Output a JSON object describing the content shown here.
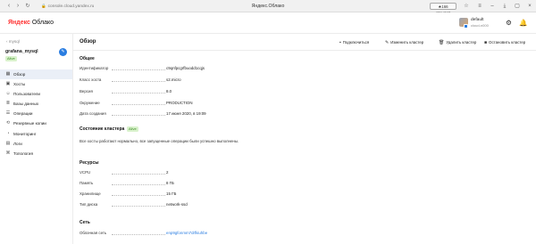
{
  "browser": {
    "url": "console.cloud.yandex.ru",
    "tab_title": "Яндекс.Облако",
    "reviews": "★166 отзывов"
  },
  "app": {
    "logo_ya": "Яндекс",
    "logo_rest": " Облако",
    "user_name": "default",
    "user_cloud": "cloud-n000"
  },
  "sidebar": {
    "back": "‹ mysql",
    "cluster_name": "grafana_mysql",
    "cluster_status": "Alive",
    "items": [
      {
        "label": "Обзор",
        "icon": "overview-icon"
      },
      {
        "label": "Хосты",
        "icon": "hosts-icon"
      },
      {
        "label": "Пользователи",
        "icon": "users-icon"
      },
      {
        "label": "Базы данных",
        "icon": "databases-icon"
      },
      {
        "label": "Операции",
        "icon": "operations-icon"
      },
      {
        "label": "Резервные копии",
        "icon": "backups-icon"
      },
      {
        "label": "Мониторинг",
        "icon": "monitoring-icon"
      },
      {
        "label": "Логи",
        "icon": "logs-icon"
      },
      {
        "label": "Топология",
        "icon": "topology-icon"
      }
    ]
  },
  "main": {
    "title": "Обзор",
    "toolbar": {
      "connect": "Подключиться",
      "edit": "Изменить кластер",
      "delete": "Удалить кластер",
      "stop": "Остановить кластер"
    },
    "general": {
      "title": "Общее",
      "rows": [
        {
          "key": "Идентификатор",
          "value": "c9qnfpcgrfbuodd1cqjs"
        },
        {
          "key": "Класс хоста",
          "value": "s2.micro"
        },
        {
          "key": "Версия",
          "value": "8.0"
        },
        {
          "key": "Окружение",
          "value": "PRODUCTION"
        },
        {
          "key": "Дата создания",
          "value": "17 июня 2020, в 19:09"
        }
      ]
    },
    "state": {
      "title": "Состояние кластера",
      "badge": "Alive",
      "text": "Все хосты работают нормально, все запущенные операции были успешно выполнены."
    },
    "resources": {
      "title": "Ресурсы",
      "rows": [
        {
          "key": "VCPU",
          "value": "2"
        },
        {
          "key": "Память",
          "value": "8 ГБ"
        },
        {
          "key": "Хранилище",
          "value": "15 ГБ"
        },
        {
          "key": "Тип диска",
          "value": "network-ssd"
        }
      ]
    },
    "network": {
      "title": "Сеть",
      "rows": [
        {
          "key": "Облачная сеть",
          "value": "enp9gfonmm7drfkiuhbe"
        }
      ]
    }
  },
  "colors": {
    "accent": "#2a7de1",
    "alive_bg": "#d9f2cc",
    "alive_fg": "#3a8b23",
    "active_nav": "#eaeff7"
  }
}
